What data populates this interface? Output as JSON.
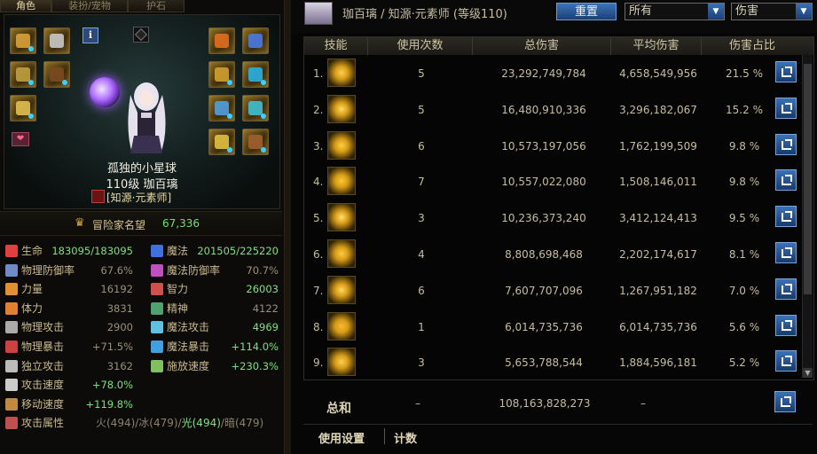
{
  "left_panel": {
    "tabs": [
      "角色",
      "装扮/宠物",
      "护石"
    ],
    "character": {
      "name": "孤独的小星球",
      "level_line": "110级  珈百璃",
      "class": "[知源·元素师]"
    },
    "fame": {
      "label": "冒险家名望",
      "value": "67,336"
    },
    "stats_left": [
      {
        "label": "生命",
        "value": "183095/183095",
        "icon": "heart-icon",
        "color": "#e04040"
      },
      {
        "label": "物理防御率",
        "value": "67.6%",
        "icon": "shield-icon",
        "color": "#6f8cc9"
      },
      {
        "label": "力量",
        "value": "16192",
        "icon": "strength-icon",
        "color": "#e09030"
      },
      {
        "label": "体力",
        "value": "3831",
        "icon": "stamina-icon",
        "color": "#e08030"
      },
      {
        "label": "物理攻击",
        "value": "2900",
        "icon": "sword-icon",
        "color": "#aaaaaa"
      },
      {
        "label": "物理暴击",
        "value": "+71.5%",
        "icon": "crosshair-icon",
        "color": "#d04040"
      },
      {
        "label": "独立攻击",
        "value": "3162",
        "icon": "spark-icon",
        "color": "#bbbbbb"
      },
      {
        "label": "攻击速度",
        "value": "+78.0%",
        "icon": "attack-speed-icon",
        "color": "#cccccc"
      },
      {
        "label": "移动速度",
        "value": "+119.8%",
        "icon": "boot-icon",
        "color": "#c08a40"
      },
      {
        "label": "攻击属性",
        "value": "",
        "icon": "element-icon",
        "color": "#c05050"
      }
    ],
    "stats_right": [
      {
        "label": "魔法",
        "value": "201505/225220",
        "icon": "mana-heart-icon",
        "color": "#4070e0"
      },
      {
        "label": "魔法防御率",
        "value": "70.7%",
        "icon": "magic-shield-icon",
        "color": "#c050c0"
      },
      {
        "label": "智力",
        "value": "26003",
        "icon": "intellect-icon",
        "color": "#d05050"
      },
      {
        "label": "精神",
        "value": "4122",
        "icon": "spirit-icon",
        "color": "#50a070"
      },
      {
        "label": "魔法攻击",
        "value": "4969",
        "icon": "magic-attack-icon",
        "color": "#60c0e0"
      },
      {
        "label": "魔法暴击",
        "value": "+114.0%",
        "icon": "magic-crit-icon",
        "color": "#40a0e0"
      },
      {
        "label": "施放速度",
        "value": "+230.3%",
        "icon": "cast-speed-icon",
        "color": "#80c060"
      }
    ],
    "element_parts": [
      "火(494)/冰(479)/",
      "光(494)",
      "/暗(479)"
    ]
  },
  "header": {
    "title": "珈百璃 / 知源·元素师 (等级110)",
    "reset_label": "重置",
    "filter_select": "所有",
    "metric_select": "伤害"
  },
  "table": {
    "columns": [
      "技能",
      "使用次数",
      "总伤害",
      "平均伤害",
      "伤害占比"
    ],
    "rows": [
      {
        "rank": "1.",
        "uses": "5",
        "total": "23,292,749,784",
        "avg": "4,658,549,956",
        "share": "21.5 %"
      },
      {
        "rank": "2.",
        "uses": "5",
        "total": "16,480,910,336",
        "avg": "3,296,182,067",
        "share": "15.2 %"
      },
      {
        "rank": "3.",
        "uses": "6",
        "total": "10,573,197,056",
        "avg": "1,762,199,509",
        "share": "9.8 %"
      },
      {
        "rank": "4.",
        "uses": "7",
        "total": "10,557,022,080",
        "avg": "1,508,146,011",
        "share": "9.8 %"
      },
      {
        "rank": "5.",
        "uses": "3",
        "total": "10,236,373,240",
        "avg": "3,412,124,413",
        "share": "9.5 %"
      },
      {
        "rank": "6.",
        "uses": "4",
        "total": "8,808,698,468",
        "avg": "2,202,174,617",
        "share": "8.1 %"
      },
      {
        "rank": "7.",
        "uses": "6",
        "total": "7,607,707,096",
        "avg": "1,267,951,182",
        "share": "7.0 %"
      },
      {
        "rank": "8.",
        "uses": "1",
        "total": "6,014,735,736",
        "avg": "6,014,735,736",
        "share": "5.6 %"
      },
      {
        "rank": "9.",
        "uses": "3",
        "total": "5,653,788,544",
        "avg": "1,884,596,181",
        "share": "5.2 %"
      }
    ],
    "total": {
      "label": "总和",
      "uses": "–",
      "total": "108,163,828,273",
      "avg": "–"
    }
  },
  "footer": {
    "usage_settings": "使用设置",
    "count": "计数"
  }
}
